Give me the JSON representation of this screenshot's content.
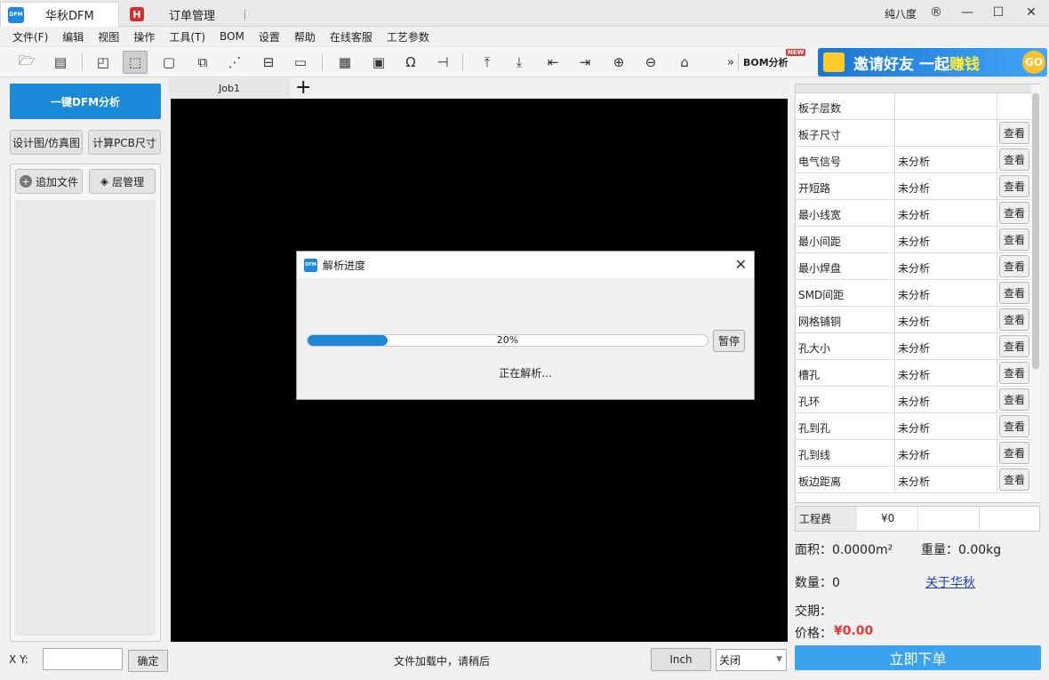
{
  "titlebar": {
    "app_tab": "华秋DFM",
    "order_tab": "订单管理",
    "user": "纯八度",
    "logo_text": "DFM",
    "h_logo": "H"
  },
  "menu": [
    "文件(F)",
    "编辑",
    "视图",
    "操作",
    "工具(T)",
    "BOM",
    "设置",
    "帮助",
    "在线客服",
    "工艺参数"
  ],
  "toolbar": {
    "bom_label": "BOM分析",
    "new_tag": "NEW",
    "more": "»",
    "banner": {
      "part1": "邀请好友",
      "part2": "一起",
      "part3": "赚钱",
      "go": "GO"
    }
  },
  "left": {
    "dfm_button": "一键DFM分析",
    "design_button": "设计图/仿真图",
    "pcb_size_button": "计算PCB尺寸",
    "add_file_button": "追加文件",
    "layer_button": "层管理"
  },
  "canvas": {
    "tab": "Job1",
    "add_tab": "+"
  },
  "dialog": {
    "title": "解析进度",
    "progress": 0.2,
    "progress_text": "20%",
    "pause_button": "暂停",
    "status": "正在解析..."
  },
  "analysis": {
    "view_label": "查看",
    "rows": [
      {
        "name": "板子层数",
        "status": "",
        "has_button": false
      },
      {
        "name": "板子尺寸",
        "status": "",
        "has_button": true
      },
      {
        "name": "电气信号",
        "status": "未分析",
        "has_button": true
      },
      {
        "name": "开短路",
        "status": "未分析",
        "has_button": true
      },
      {
        "name": "最小线宽",
        "status": "未分析",
        "has_button": true
      },
      {
        "name": "最小间距",
        "status": "未分析",
        "has_button": true
      },
      {
        "name": "最小焊盘",
        "status": "未分析",
        "has_button": true
      },
      {
        "name": "SMD间距",
        "status": "未分析",
        "has_button": true
      },
      {
        "name": "网格铺铜",
        "status": "未分析",
        "has_button": true
      },
      {
        "name": "孔大小",
        "status": "未分析",
        "has_button": true
      },
      {
        "name": "槽孔",
        "status": "未分析",
        "has_button": true
      },
      {
        "name": "孔环",
        "status": "未分析",
        "has_button": true
      },
      {
        "name": "孔到孔",
        "status": "未分析",
        "has_button": true
      },
      {
        "name": "孔到线",
        "status": "未分析",
        "has_button": true
      },
      {
        "name": "板边距离",
        "status": "未分析",
        "has_button": true
      }
    ]
  },
  "summary": {
    "fee_label": "工程费",
    "fee_value": "¥0",
    "area": "面积：0.0000m²",
    "weight": "重量：0.00kg",
    "quantity": "数量：0",
    "about_link": "关于华秋",
    "delivery": "交期：",
    "price_label": "价格：",
    "price_value": "¥0.00",
    "order_button": "立即下单"
  },
  "statusbar": {
    "xy_label": "X Y:",
    "ok_button": "确定",
    "message": "文件加载中，请稍后",
    "unit_button": "Inch",
    "select_value": "关闭"
  },
  "colors": {
    "accent": "#1a8ad8",
    "progress": "#1e88d6",
    "price": "#e53935",
    "order_button": "#3ba2f0"
  }
}
